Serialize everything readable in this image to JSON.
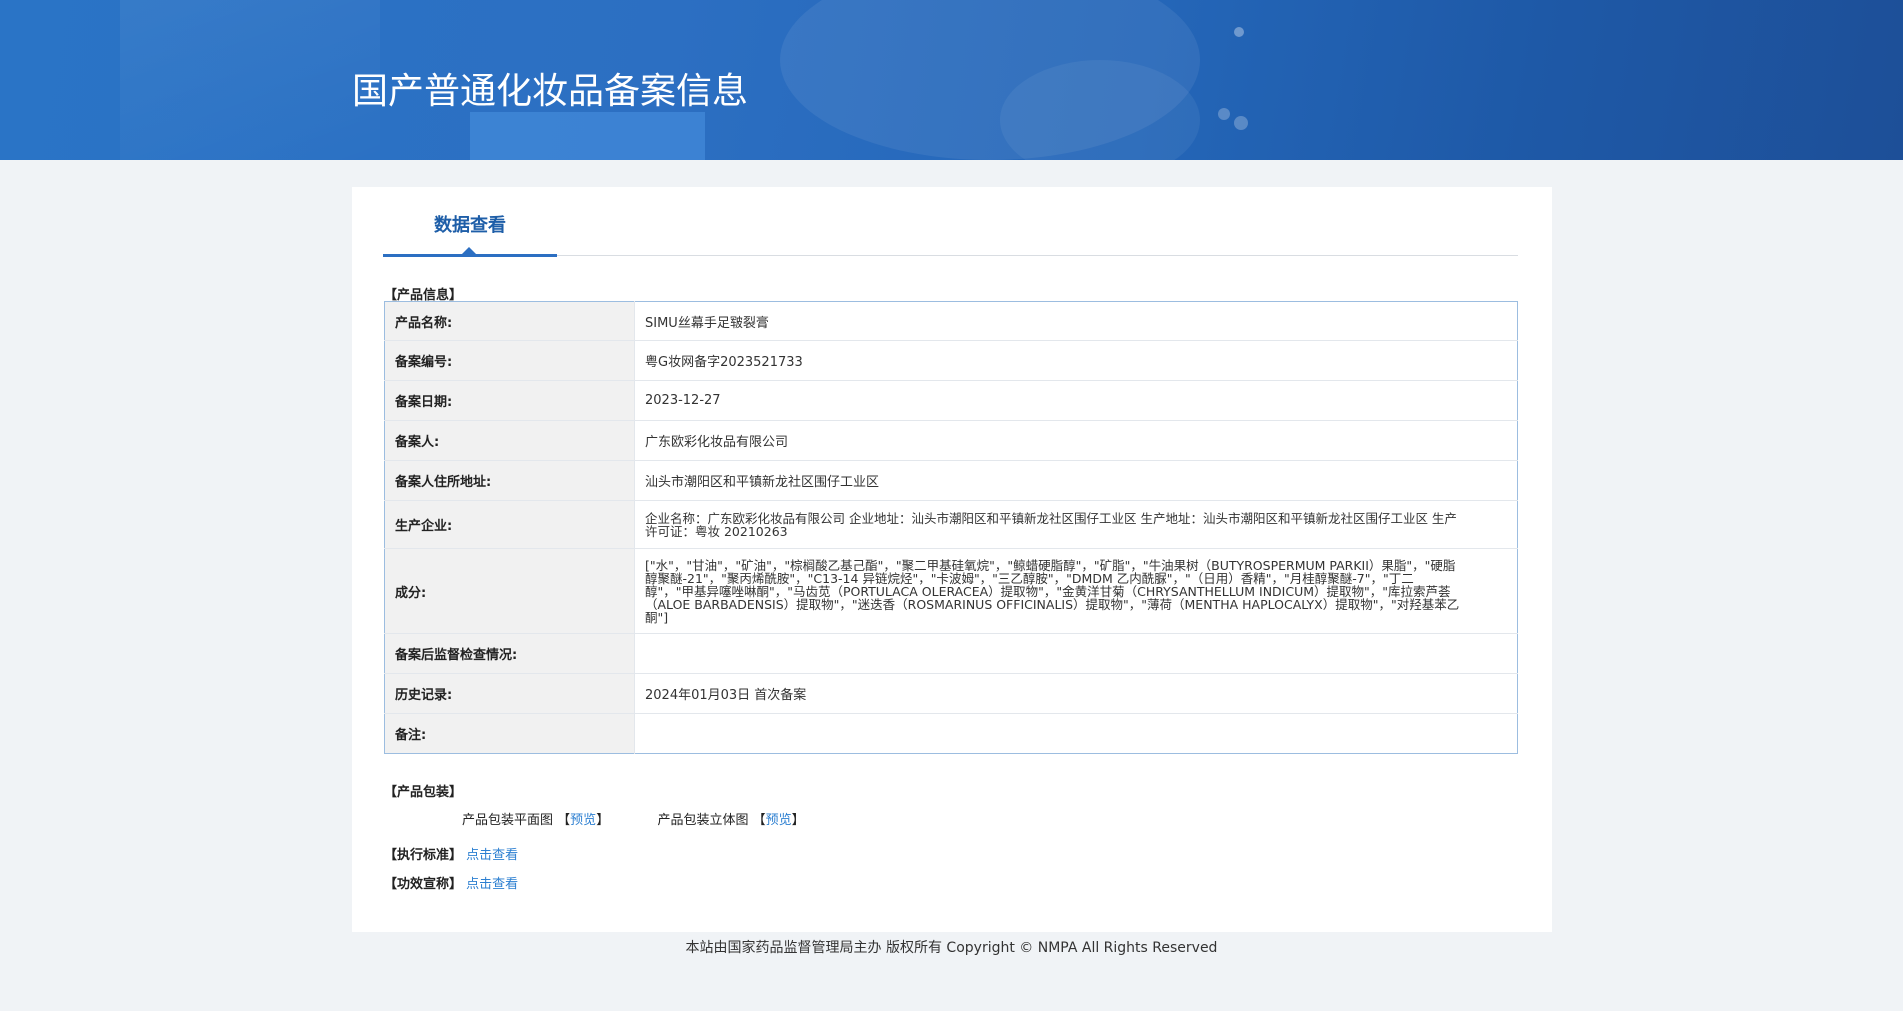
{
  "header": {
    "title": "国产普通化妆品备案信息"
  },
  "tab": {
    "label": "数据查看"
  },
  "product_section": {
    "heading": "【产品信息】",
    "rows": [
      {
        "label": "产品名称:",
        "value": "SIMU丝幕手足皲裂膏"
      },
      {
        "label": "备案编号:",
        "value": "粤G妆网备字2023521733"
      },
      {
        "label": "备案日期:",
        "value": "2023-12-27"
      },
      {
        "label": "备案人:",
        "value": "广东欧彩化妆品有限公司"
      },
      {
        "label": "备案人住所地址:",
        "value": "汕头市潮阳区和平镇新龙社区围仔工业区"
      },
      {
        "label": "生产企业:",
        "value": "企业名称：广东欧彩化妆品有限公司 企业地址：汕头市潮阳区和平镇新龙社区围仔工业区 生产地址：汕头市潮阳区和平镇新龙社区围仔工业区 生产许可证：粤妆 20210263"
      },
      {
        "label": "成分:",
        "value": "[\"水\"，\"甘油\"，\"矿油\"，\"棕榈酸乙基己酯\"，\"聚二甲基硅氧烷\"，\"鲸蜡硬脂醇\"，\"矿脂\"，\"牛油果树（BUTYROSPERMUM PARKII）果脂\"，\"硬脂醇聚醚-21\"，\"聚丙烯酰胺\"，\"C13-14 异链烷烃\"，\"卡波姆\"，\"三乙醇胺\"，\"DMDM 乙内酰脲\"，\"（日用）香精\"，\"月桂醇聚醚-7\"，\"丁二醇\"，\"甲基异噻唑啉酮\"，\"马齿苋（PORTULACA OLERACEA）提取物\"，\"金黄洋甘菊（CHRYSANTHELLUM INDICUM）提取物\"，\"库拉索芦荟（ALOE BARBADENSIS）提取物\"，\"迷迭香（ROSMARINUS OFFICINALIS）提取物\"，\"薄荷（MENTHA HAPLOCALYX）提取物\"，\"对羟基苯乙酮\"]"
      },
      {
        "label": "备案后监督检查情况:",
        "value": ""
      },
      {
        "label": "历史记录:",
        "value": "2024年01月03日 首次备案"
      },
      {
        "label": "备注:",
        "value": ""
      }
    ]
  },
  "package_section": {
    "heading": "【产品包装】",
    "flat_label": "产品包装平面图",
    "solid_label": "产品包装立体图",
    "bracket_open": "【",
    "bracket_close": "】",
    "preview_link": "预览"
  },
  "standard": {
    "heading": "【执行标准】",
    "link": "点击查看"
  },
  "efficacy": {
    "heading": "【功效宣称】",
    "link": "点击查看"
  },
  "footer": {
    "text": "本站由国家药品监督管理局主办 版权所有 Copyright © NMPA All Rights Reserved"
  }
}
